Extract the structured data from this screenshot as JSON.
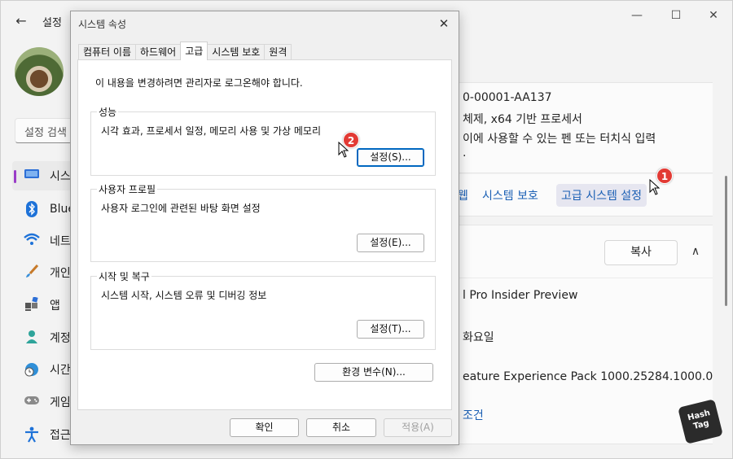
{
  "settings": {
    "app_title": "설정",
    "back_glyph": "←",
    "window_controls": {
      "minimize": "—",
      "maximize": "☐",
      "close": "✕"
    },
    "search_placeholder": "설정 검색",
    "nav": [
      {
        "label": "시스",
        "icon": "monitor-icon",
        "active": true
      },
      {
        "label": "Blue",
        "icon": "bluetooth-icon"
      },
      {
        "label": "네트",
        "icon": "wifi-icon"
      },
      {
        "label": "개인",
        "icon": "brush-icon"
      },
      {
        "label": "앱",
        "icon": "apps-icon"
      },
      {
        "label": "계정",
        "icon": "account-icon"
      },
      {
        "label": "시간",
        "icon": "clock-globe-icon"
      },
      {
        "label": "게임",
        "icon": "gamepad-icon"
      },
      {
        "label": "접근",
        "icon": "accessibility-icon"
      }
    ],
    "device_lines": [
      "0-00001-AA137",
      "체제, x64 기반 프로세서",
      "이에 사용할 수 있는 펜 또는 터치식 입력",
      "."
    ],
    "links": {
      "partial": "웹",
      "system_protection": "시스템 보호",
      "advanced_settings": "고급 시스템 설정"
    },
    "copy_label": "복사",
    "collapse_glyph": "∧",
    "spec_lines": [
      "l Pro Insider Preview",
      "화요일",
      "eature Experience Pack 1000.25284.1000.0"
    ],
    "terms_link": "조건",
    "watermark": "Hash Tag"
  },
  "badges": {
    "step1": "1",
    "step2": "2"
  },
  "dialog": {
    "title": "시스템 속성",
    "close_glyph": "✕",
    "tabs": [
      "컴퓨터 이름",
      "하드웨어",
      "고급",
      "시스템 보호",
      "원격"
    ],
    "active_tab": "고급",
    "admin_note": "이 내용을 변경하려면 관리자로 로그온해야 합니다.",
    "performance": {
      "label": "성능",
      "desc": "시각 효과, 프로세서 일정, 메모리 사용 및 가상 메모리",
      "button": "설정(S)..."
    },
    "user_profiles": {
      "label": "사용자 프로필",
      "desc": "사용자 로그인에 관련된 바탕 화면 설정",
      "button": "설정(E)..."
    },
    "startup_recovery": {
      "label": "시작 및 복구",
      "desc": "시스템 시작, 시스템 오류 및 디버깅 정보",
      "button": "설정(T)..."
    },
    "env_button": "환경 변수(N)...",
    "ok": "확인",
    "cancel": "취소",
    "apply": "적용(A)"
  }
}
